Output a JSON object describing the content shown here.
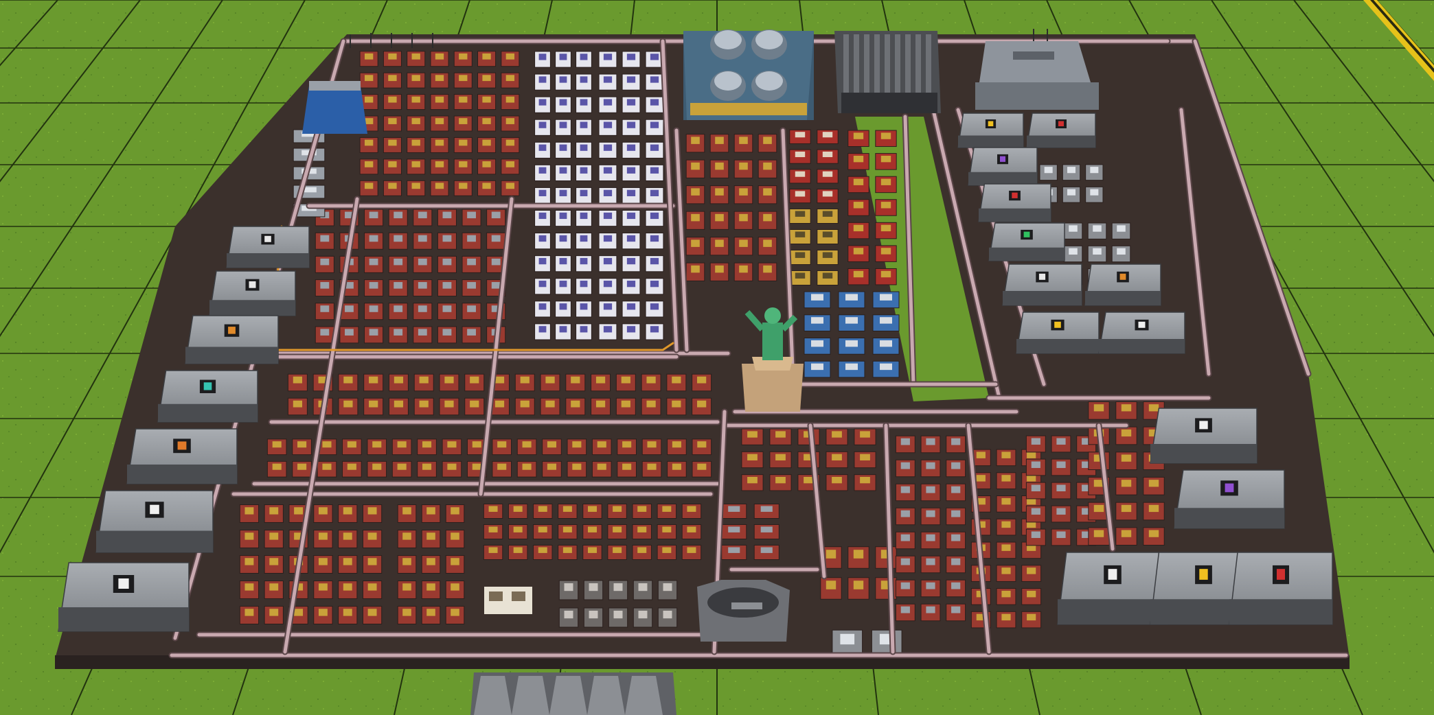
{
  "scene": {
    "kind": "isometric factory-building game view",
    "palette": {
      "grass": "#6a9a2e",
      "grass_dark": "#55802a",
      "grid_line": "#22330f",
      "belt": "#c9a9b0",
      "belt_edge": "#5a4548",
      "floor": "#3a3230",
      "machine_red": "#9a3a30",
      "machine_white": "#e6e6ee",
      "machine_blue": "#3b6fb0",
      "machine_yellow": "#c9a23a",
      "container": "#8c8f94",
      "container_dark": "#4a4c50",
      "statue": "#3fa06a",
      "hazard_yellow": "#e6c21a"
    },
    "icons": {
      "left_containers": [
        "chevron-icon",
        "gear-icon",
        "orange-diamond-icon",
        "teal-gem-icon",
        "orange-ore-icon",
        "white-diamond-icon",
        "white-diamond-icon"
      ],
      "right_upper_containers": [
        "yellow-arrow-icon",
        "red-cross-icon",
        "purple-module-icon",
        "red-module-icon",
        "green-module-icon",
        "envelope-icon",
        "orange-arrow-icon",
        "yellow-arrow-icon",
        "white-arrow-icon"
      ],
      "right_lower_containers": [
        "grid-icon",
        "purple-chip-icon",
        "white-science-icon",
        "yellow-science-icon",
        "red-science-icon"
      ]
    }
  }
}
